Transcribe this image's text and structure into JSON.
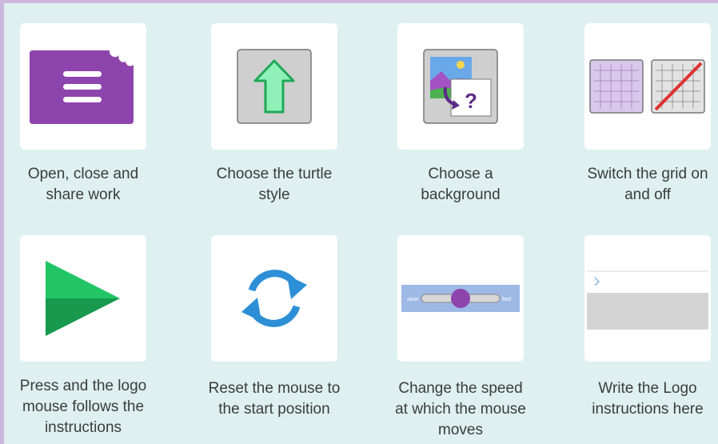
{
  "help_items": [
    {
      "caption": "Open, close and\nshare work",
      "icon": "menu-folder-icon"
    },
    {
      "caption": "Choose the turtle\nstyle",
      "icon": "turtle-arrow-icon"
    },
    {
      "caption": "Choose a\nbackground",
      "icon": "background-picture-icon"
    },
    {
      "caption": "Switch the grid on\nand off",
      "icon": "grid-toggle-icon"
    },
    {
      "caption": "Press and the logo\nmouse follows the\ninstructions",
      "icon": "play-icon"
    },
    {
      "caption": "Reset the mouse to\nthe start position",
      "icon": "reset-icon"
    },
    {
      "caption": "Change the speed\nat which the mouse\nmoves",
      "icon": "speed-slider-icon"
    },
    {
      "caption": "Write the Logo\ninstructions here",
      "icon": "instructions-editor-icon"
    }
  ],
  "speed_slider": {
    "min_label": "slow",
    "max_label": "fast",
    "level": 0.5
  },
  "colors": {
    "background": "#def0f0",
    "frame": "#cdb8dd",
    "accent_purple": "#8e44ad",
    "play_green": "#1fb45b"
  }
}
